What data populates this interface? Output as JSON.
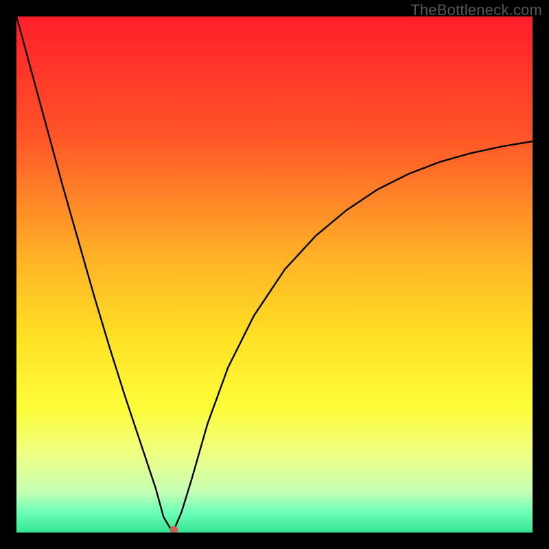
{
  "watermark": "TheBottleneck.com",
  "chart_data": {
    "type": "line",
    "title": "",
    "xlabel": "",
    "ylabel": "",
    "xlim": [
      0,
      1
    ],
    "ylim": [
      0,
      1
    ],
    "gradient_stops": [
      {
        "offset": 0.0,
        "color": "#ff1e2b"
      },
      {
        "offset": 0.23,
        "color": "#ff5428"
      },
      {
        "offset": 0.47,
        "color": "#ffb327"
      },
      {
        "offset": 0.62,
        "color": "#ffe024"
      },
      {
        "offset": 0.76,
        "color": "#fdfd3a"
      },
      {
        "offset": 0.85,
        "color": "#efff86"
      },
      {
        "offset": 0.92,
        "color": "#c6ffb3"
      },
      {
        "offset": 0.96,
        "color": "#6fffb8"
      },
      {
        "offset": 1.0,
        "color": "#35e595"
      }
    ],
    "marker": {
      "x": 0.305,
      "y": 0.005,
      "color": "#c86458"
    },
    "series": [
      {
        "name": "curve",
        "x": [
          0.0,
          0.03,
          0.06,
          0.09,
          0.12,
          0.15,
          0.18,
          0.21,
          0.24,
          0.27,
          0.285,
          0.3,
          0.305,
          0.32,
          0.34,
          0.37,
          0.41,
          0.46,
          0.52,
          0.58,
          0.64,
          0.7,
          0.76,
          0.82,
          0.88,
          0.94,
          1.0
        ],
        "y": [
          1.0,
          0.89,
          0.78,
          0.67,
          0.565,
          0.46,
          0.36,
          0.265,
          0.175,
          0.085,
          0.03,
          0.005,
          0.005,
          0.04,
          0.105,
          0.21,
          0.32,
          0.42,
          0.51,
          0.575,
          0.625,
          0.665,
          0.695,
          0.718,
          0.735,
          0.748,
          0.758
        ]
      }
    ]
  }
}
